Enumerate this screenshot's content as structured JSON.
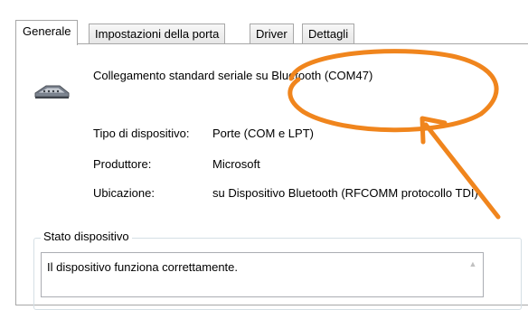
{
  "tabs": [
    {
      "label": "Generale",
      "active": true
    },
    {
      "label": "Impostazioni della porta",
      "active": false
    },
    {
      "label": "Driver",
      "active": false
    },
    {
      "label": "Dettagli",
      "active": false
    }
  ],
  "device": {
    "name": "Collegamento standard seriale su Bluetooth (COM47)",
    "icon": "serial-port-icon"
  },
  "properties": [
    {
      "label": "Tipo di dispositivo:",
      "value": "Porte (COM e LPT)"
    },
    {
      "label": "Produttore:",
      "value": "Microsoft"
    },
    {
      "label": "Ubicazione:",
      "value": "su Dispositivo Bluetooth (RFCOMM protocollo TDI)"
    }
  ],
  "status": {
    "group_title": "Stato dispositivo",
    "text": "Il dispositivo funziona correttamente."
  },
  "colors": {
    "annotation": "#f0851d"
  }
}
